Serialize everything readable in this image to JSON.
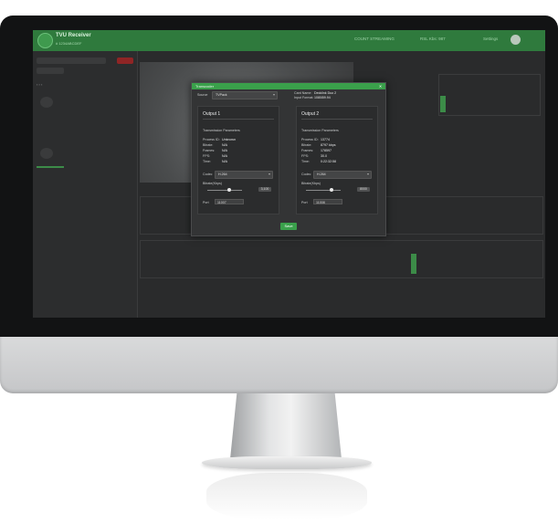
{
  "app": {
    "name": "TVU Receiver",
    "subtitle": "# 1234ABCDEF",
    "nav": [
      "COUNT STREAMING",
      "RSL Kbs: 987",
      "Settings"
    ]
  },
  "modal": {
    "title": "Transcoder",
    "source_label": "Source",
    "source_value": "TVPack",
    "card_name_label": "Card Name:",
    "card_name_value": "Decklink Duo 2",
    "input_format_label": "Input Format:",
    "input_format_value": "1080i59.94",
    "save_label": "Save",
    "close_glyph": "✕",
    "outputs": [
      {
        "title": "Output 1",
        "params_heading": "Transmission Parameters",
        "process_id": "Unknown",
        "bitrate": "N/A",
        "frames": "N/A",
        "fps": "N/A",
        "time": "N/A",
        "codec": "H.264",
        "bitrate_kbps_label": "Bitrate(Kbps)",
        "bitrate_value": "3,100",
        "port": "11007"
      },
      {
        "title": "Output 2",
        "params_heading": "Transmission Parameters",
        "process_id": "13774",
        "bitrate": "8797 kbps",
        "frames": "178597",
        "fps": "30.0",
        "time": "0:22:32:58",
        "codec": "H.264",
        "bitrate_kbps_label": "Bitrate(Kbps)",
        "bitrate_value": "8000",
        "port": "11008"
      }
    ],
    "field_labels": {
      "process_id": "Process ID:",
      "bitrate": "Bitrate:",
      "frames": "Frames:",
      "fps": "FPS:",
      "time": "Time:",
      "codec": "Codec",
      "port": "Port"
    }
  },
  "colors": {
    "accent": "#3aa04b",
    "topbar": "#2f7a3d",
    "danger": "#8f2525"
  }
}
